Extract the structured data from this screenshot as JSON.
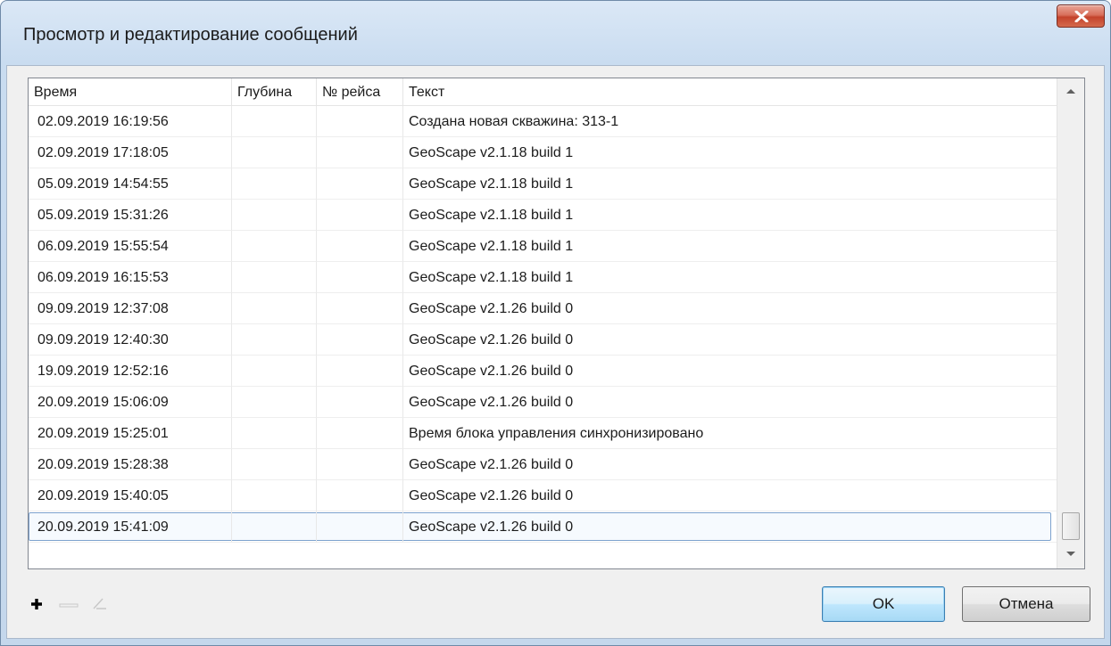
{
  "window": {
    "title": "Просмотр и редактирование сообщений"
  },
  "table": {
    "columns": [
      "Время",
      "Глубина",
      "№ рейса",
      "Текст"
    ],
    "rows": [
      [
        "02.09.2019 16:19:56",
        "",
        "",
        "Создана новая скважина: 313-1"
      ],
      [
        "02.09.2019 17:18:05",
        "",
        "",
        "GeoScape v2.1.18 build 1"
      ],
      [
        "05.09.2019 14:54:55",
        "",
        "",
        "GeoScape v2.1.18 build 1"
      ],
      [
        "05.09.2019 15:31:26",
        "",
        "",
        "GeoScape v2.1.18 build 1"
      ],
      [
        "06.09.2019 15:55:54",
        "",
        "",
        "GeoScape v2.1.18 build 1"
      ],
      [
        "06.09.2019 16:15:53",
        "",
        "",
        "GeoScape v2.1.18 build 1"
      ],
      [
        "09.09.2019 12:37:08",
        "",
        "",
        "GeoScape v2.1.26 build 0"
      ],
      [
        "09.09.2019 12:40:30",
        "",
        "",
        "GeoScape v2.1.26 build 0"
      ],
      [
        "19.09.2019 12:52:16",
        "",
        "",
        "GeoScape v2.1.26 build 0"
      ],
      [
        "20.09.2019 15:06:09",
        "",
        "",
        "GeoScape v2.1.26 build 0"
      ],
      [
        "20.09.2019 15:25:01",
        "",
        "",
        "Время блока управления синхронизировано"
      ],
      [
        "20.09.2019 15:28:38",
        "",
        "",
        "GeoScape v2.1.26 build 0"
      ],
      [
        "20.09.2019 15:40:05",
        "",
        "",
        "GeoScape v2.1.26 build 0"
      ],
      [
        "20.09.2019 15:41:09",
        "",
        "",
        "GeoScape v2.1.26 build 0"
      ]
    ],
    "selected_row": 13
  },
  "toolbar": {
    "icons": [
      "plus-icon",
      "minus-icon",
      "edit-icon"
    ]
  },
  "buttons": {
    "ok": "OK",
    "cancel": "Отмена"
  },
  "colors": {
    "close_button": "#c4432c",
    "selection_border": "#7da2ce",
    "default_button_border": "#3c7fb1"
  }
}
